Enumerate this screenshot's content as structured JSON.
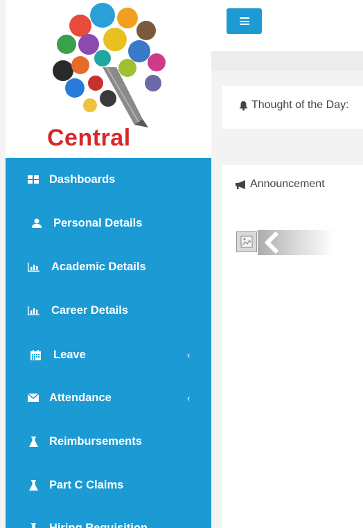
{
  "brand": {
    "logo_text": "Central"
  },
  "topbar": {
    "menu_icon": "hamburger-icon"
  },
  "sidebar": {
    "items": [
      {
        "label": "Dashboards",
        "icon": "dashboard-grid-icon",
        "has_submenu": false
      },
      {
        "label": "Personal Details",
        "icon": "user-icon",
        "has_submenu": false
      },
      {
        "label": "Academic Details",
        "icon": "bar-chart-icon",
        "has_submenu": false
      },
      {
        "label": "Career Details",
        "icon": "bar-chart-icon",
        "has_submenu": false
      },
      {
        "label": "Leave",
        "icon": "calendar-icon",
        "has_submenu": true,
        "chevron": "‹"
      },
      {
        "label": "Attendance",
        "icon": "envelope-icon",
        "has_submenu": true,
        "chevron": "‹"
      },
      {
        "label": "Reimbursements",
        "icon": "flask-icon",
        "has_submenu": false
      },
      {
        "label": "Part C Claims",
        "icon": "flask-icon",
        "has_submenu": false
      },
      {
        "label": "Hiring Requisition",
        "icon": "flask-icon",
        "has_submenu": false
      }
    ]
  },
  "main": {
    "thought": {
      "title": "Thought of the Day:",
      "icon": "bell-icon"
    },
    "announcement": {
      "title": "Announcement",
      "icon": "bullhorn-icon",
      "image_icon": "broken-image-icon",
      "prev_icon": "chevron-left-icon"
    }
  },
  "colors": {
    "accent": "#1b9ad4",
    "logo_red": "#d8262a",
    "page_bg": "#f3f3f3",
    "card_bg": "#ffffff"
  }
}
